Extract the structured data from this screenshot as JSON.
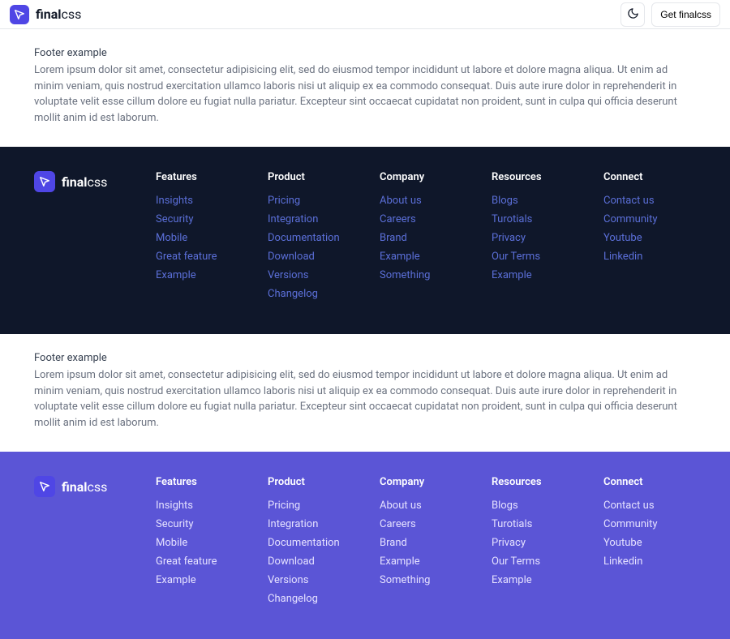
{
  "header": {
    "brand_bold": "final",
    "brand_light": "css",
    "cta": "Get finalcss"
  },
  "example": {
    "title": "Footer example",
    "body": "Lorem ipsum dolor sit amet, consectetur adipisicing elit, sed do eiusmod tempor incididunt ut labore et dolore magna aliqua. Ut enim ad minim veniam, quis nostrud exercitation ullamco laboris nisi ut aliquip ex ea commodo consequat. Duis aute irure dolor in reprehenderit in voluptate velit esse cillum dolore eu fugiat nulla pariatur. Excepteur sint occaecat cupidatat non proident, sunt in culpa qui officia deserunt mollit anim id est laborum."
  },
  "footer": {
    "columns": [
      {
        "title": "Features",
        "links": [
          "Insights",
          "Security",
          "Mobile",
          "Great feature",
          "Example"
        ]
      },
      {
        "title": "Product",
        "links": [
          "Pricing",
          "Integration",
          "Documentation",
          "Download",
          "Versions",
          "Changelog"
        ]
      },
      {
        "title": "Company",
        "links": [
          "About us",
          "Careers",
          "Brand",
          "Example",
          "Something"
        ]
      },
      {
        "title": "Resources",
        "links": [
          "Blogs",
          "Turotials",
          "Privacy",
          "Our Terms",
          "Example"
        ]
      },
      {
        "title": "Connect",
        "links": [
          "Contact us",
          "Community",
          "Youtube",
          "Linkedin"
        ]
      }
    ]
  }
}
